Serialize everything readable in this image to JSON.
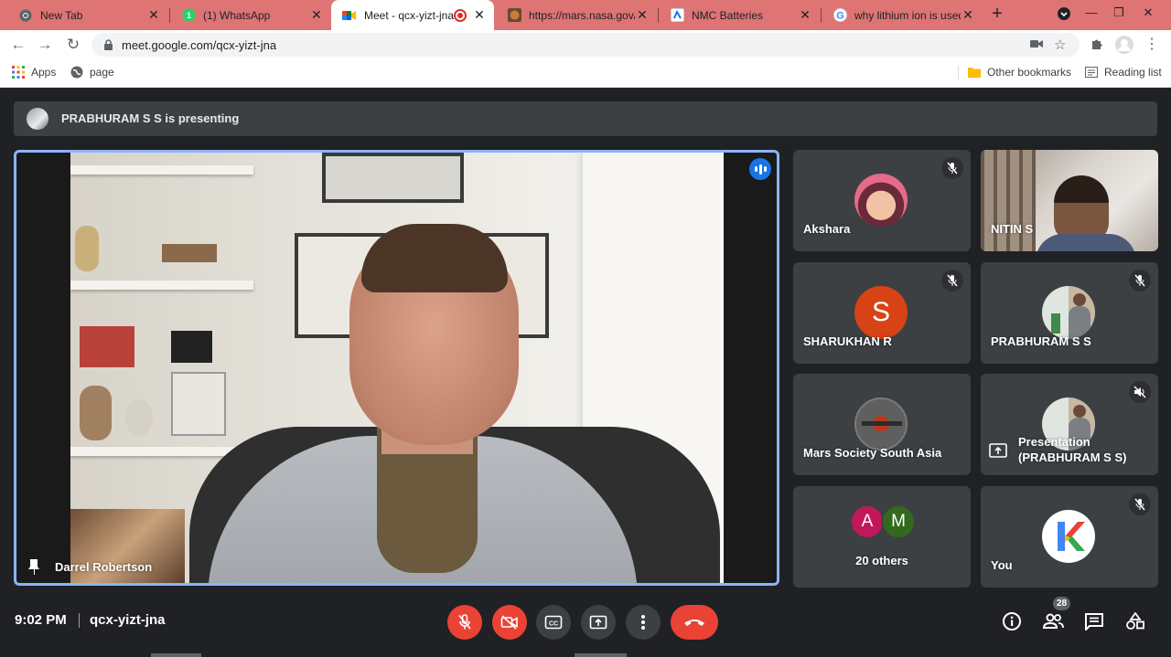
{
  "browser": {
    "tabs": [
      {
        "title": "New Tab",
        "icon": "chrome-icon"
      },
      {
        "title": "(1) WhatsApp",
        "icon": "whatsapp-icon"
      },
      {
        "title": "Meet - qcx-yizt-jna",
        "icon": "meet-icon",
        "active": true,
        "recording": true
      },
      {
        "title": "https://mars.nasa.gov/",
        "icon": "nasa-icon"
      },
      {
        "title": "NMC Batteries",
        "icon": "page-icon"
      },
      {
        "title": "why lithium ion is used",
        "icon": "google-icon"
      }
    ],
    "url": "meet.google.com/qcx-yizt-jna",
    "bookmarks": {
      "apps": "Apps",
      "page": "page",
      "other": "Other bookmarks",
      "reading": "Reading list"
    }
  },
  "meet": {
    "banner": "PRABHURAM S S is presenting",
    "main_speaker": "Darrel Robertson",
    "tiles": [
      {
        "name": "Akshara",
        "muted": true
      },
      {
        "name": "NITIN S",
        "muted": false
      },
      {
        "name": "SHARUKHAN R",
        "muted": true,
        "initial": "S"
      },
      {
        "name": "PRABHURAM S S",
        "muted": true
      },
      {
        "name": "Mars Society South Asia",
        "muted": false
      },
      {
        "name": "Presentation\n(PRABHURAM S S)",
        "muted": true
      },
      {
        "name": "20 others",
        "initials": [
          "A",
          "M"
        ]
      },
      {
        "name": "You",
        "muted": true
      }
    ],
    "footer": {
      "time": "9:02 PM",
      "meeting_code": "qcx-yizt-jna",
      "participants_count": "28"
    },
    "colors": {
      "accent_blue": "#8ab4f8",
      "danger_red": "#ea4335",
      "tile_bg": "#3c4043",
      "page_bg": "#202124"
    }
  }
}
